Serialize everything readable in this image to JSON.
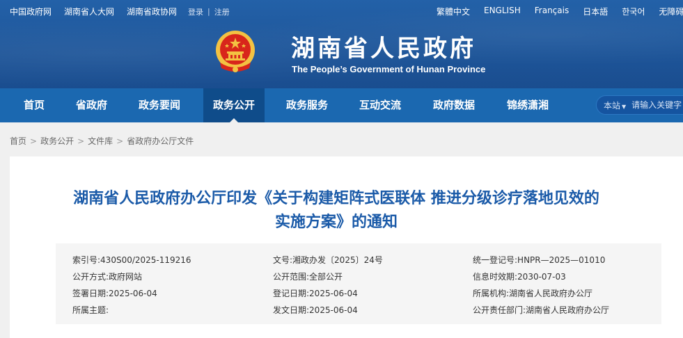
{
  "topbar": {
    "links": [
      "中国政府网",
      "湖南省人大网",
      "湖南省政协网"
    ],
    "login": "登录",
    "sep": "|",
    "register": "注册",
    "languages": [
      "繁體中文",
      "ENGLISH",
      "Français",
      "日本語",
      "한국어",
      "无障碍浏览"
    ]
  },
  "header": {
    "title": "湖南省人民政府",
    "subtitle": "The People’s Government of Hunan Province"
  },
  "nav": {
    "items": [
      "首页",
      "省政府",
      "政务要闻",
      "政务公开",
      "政务服务",
      "互动交流",
      "政府数据",
      "锦绣潇湘"
    ],
    "active_index": 3
  },
  "search": {
    "scope": "本站",
    "placeholder": "请输入关键字"
  },
  "breadcrumb": [
    "首页",
    "政务公开",
    "文件库",
    "省政府办公厅文件"
  ],
  "article": {
    "title_line1": "湖南省人民政府办公厅印发《关于构建矩阵式医联体 推进分级诊疗落地见效的",
    "title_line2": "实施方案》的通知"
  },
  "meta": {
    "rows": [
      [
        {
          "k": "索引号:",
          "v": "430S00/2025-119216"
        },
        {
          "k": "文号:",
          "v": "湘政办发〔2025〕24号"
        },
        {
          "k": "统一登记号:",
          "v": "HNPR—2025—01010"
        }
      ],
      [
        {
          "k": "公开方式:",
          "v": "政府网站"
        },
        {
          "k": "公开范围:",
          "v": "全部公开"
        },
        {
          "k": "信息时效期:",
          "v": "2030-07-03"
        }
      ],
      [
        {
          "k": "签署日期:",
          "v": "2025-06-04"
        },
        {
          "k": "登记日期:",
          "v": "2025-06-04"
        },
        {
          "k": "所属机构:",
          "v": "湖南省人民政府办公厅"
        }
      ],
      [
        {
          "k": "所属主题:",
          "v": ""
        },
        {
          "k": "发文日期:",
          "v": "2025-06-04"
        },
        {
          "k": "公开责任部门:",
          "v": "湖南省人民政府办公厅"
        }
      ]
    ]
  },
  "colors": {
    "header_bg": "#1f5597",
    "nav_bg": "#1b68b0",
    "nav_active": "#0f4c8a",
    "title_blue": "#1a5aa8",
    "emblem_red": "#d8261b",
    "emblem_gold": "#f3c242"
  }
}
